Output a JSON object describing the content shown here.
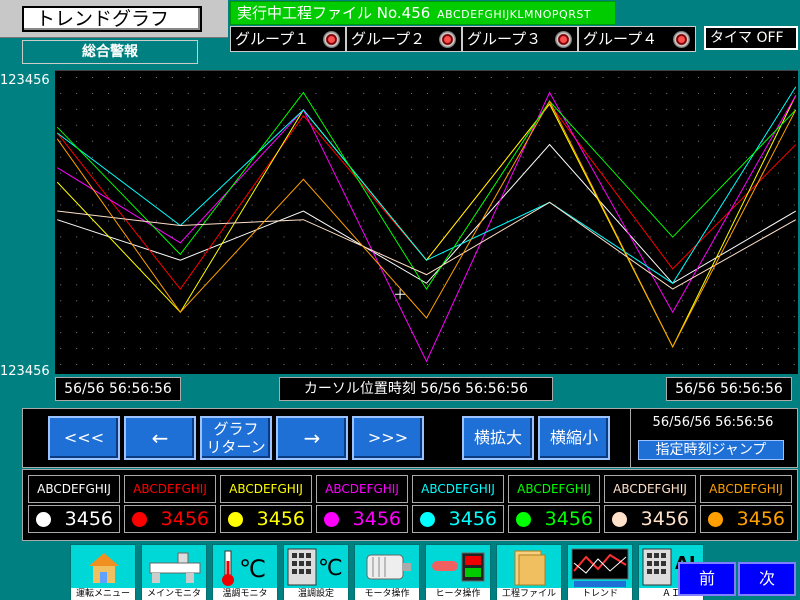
{
  "header": {
    "title": "トレンドグラフ",
    "alarm_label": "総合警報",
    "file_banner_main": "実行中工程ファイル No.456",
    "file_banner_code": "ABCDEFGHIJKLMNOPQRST",
    "groups": [
      "グループ１",
      "グループ２",
      "グループ３",
      "グループ４"
    ],
    "timer_label": "タイマ OFF"
  },
  "axis": {
    "y_top": "123456",
    "y_bottom": "123456"
  },
  "times": {
    "left": "56/56 56:56:56",
    "cursor_label": "カーソル位置時刻",
    "cursor": "56/56 56:56:56",
    "right": "56/56 56:56:56"
  },
  "nav": {
    "first": "<<<",
    "prev": "←",
    "graph_return_line1": "グラフ",
    "graph_return_line2": "リターン",
    "next": "→",
    "last": ">>>",
    "zoom_in": "横拡大",
    "zoom_out": "横縮小",
    "jump_time": "56/56/56 56:56:56",
    "jump_label": "指定時刻ジャンプ"
  },
  "legend": [
    {
      "name": "ABCDEFGHIJ",
      "value": "3456",
      "color": "#ffffff"
    },
    {
      "name": "ABCDEFGHIJ",
      "value": "3456",
      "color": "#ff0000"
    },
    {
      "name": "ABCDEFGHIJ",
      "value": "3456",
      "color": "#ffff00"
    },
    {
      "name": "ABCDEFGHIJ",
      "value": "3456",
      "color": "#ff00ff"
    },
    {
      "name": "ABCDEFGHIJ",
      "value": "3456",
      "color": "#00ffff"
    },
    {
      "name": "ABCDEFGHIJ",
      "value": "3456",
      "color": "#00ff00"
    },
    {
      "name": "ABCDEFGHIJ",
      "value": "3456",
      "color": "#ffe0c8"
    },
    {
      "name": "ABCDEFGHIJ",
      "value": "3456",
      "color": "#ffa000"
    }
  ],
  "menu": [
    {
      "label": "運転メニュー",
      "icon": "house-icon"
    },
    {
      "label": "メインモニタ",
      "icon": "machine-icon"
    },
    {
      "label": "温調モニタ",
      "icon": "thermometer-icon"
    },
    {
      "label": "温調設定",
      "icon": "keypad-celsius-icon"
    },
    {
      "label": "モータ操作",
      "icon": "motor-icon"
    },
    {
      "label": "ヒータ操作",
      "icon": "heater-switch-icon"
    },
    {
      "label": "工程ファイル",
      "icon": "folder-icon"
    },
    {
      "label": "トレンド",
      "icon": "trend-icon"
    },
    {
      "label": "ＡＩ",
      "icon": "keypad-ai-icon"
    }
  ],
  "paging": {
    "prev": "前",
    "next": "次"
  },
  "chart_data": {
    "type": "line",
    "x": [
      0,
      1,
      2,
      3,
      4,
      5,
      6
    ],
    "ylim": [
      0,
      100
    ],
    "grid": true,
    "series": [
      {
        "color": "#ffffff",
        "values": [
          52,
          38,
          55,
          30,
          78,
          30,
          55
        ]
      },
      {
        "color": "#ff0000",
        "values": [
          82,
          28,
          88,
          38,
          92,
          35,
          78
        ]
      },
      {
        "color": "#ffff00",
        "values": [
          65,
          20,
          90,
          38,
          92,
          8,
          95
        ]
      },
      {
        "color": "#ff00ff",
        "values": [
          70,
          44,
          90,
          3,
          96,
          20,
          95
        ]
      },
      {
        "color": "#00ffff",
        "values": [
          82,
          50,
          90,
          38,
          58,
          30,
          98
        ]
      },
      {
        "color": "#00ff00",
        "values": [
          84,
          40,
          96,
          28,
          93,
          46,
          90
        ]
      },
      {
        "color": "#ffe0c8",
        "values": [
          55,
          50,
          52,
          33,
          58,
          28,
          52
        ]
      },
      {
        "color": "#ffa000",
        "values": [
          80,
          20,
          66,
          18,
          93,
          8,
          90
        ]
      }
    ]
  }
}
